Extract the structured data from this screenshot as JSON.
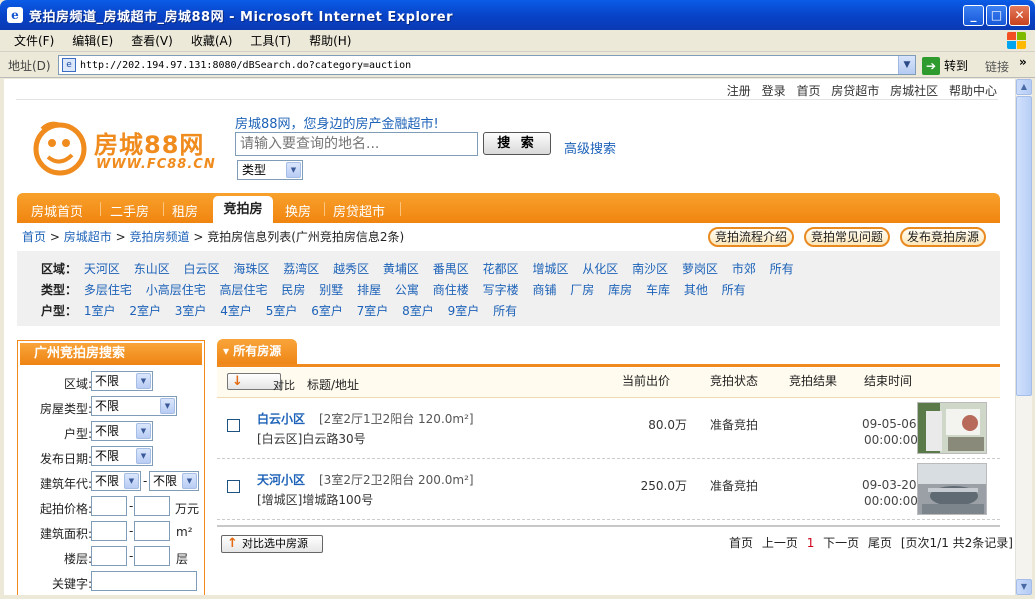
{
  "window": {
    "title": "竞拍房频道_房城超市_房城88网 - Microsoft Internet Explorer",
    "app_icon_glyph": "e",
    "btn_min": "_",
    "btn_max": "□",
    "btn_close": "✕"
  },
  "menu": [
    "文件(F)",
    "编辑(E)",
    "查看(V)",
    "收藏(A)",
    "工具(T)",
    "帮助(H)"
  ],
  "address": {
    "label": "地址(D)",
    "url": "http://202.194.97.131:8080/dBSearch.do?category=auction",
    "go": "转到",
    "links": "链接",
    "chevron": "»"
  },
  "top_links": [
    "注册",
    "登录",
    "首页",
    "房贷超市",
    "房城社区",
    "帮助中心"
  ],
  "logo": {
    "brand": "房城88网",
    "url": "WWW.FC88.CN"
  },
  "search": {
    "slogan": "房城88网，您身边的房产金融超市!",
    "placeholder": "请输入要查询的地名...",
    "button": "搜 索",
    "advanced": "高级搜索",
    "type": "类型"
  },
  "nav": {
    "items": [
      "房城首页",
      "二手房",
      "租房",
      "竞拍房",
      "换房",
      "房贷超市"
    ],
    "active": "竞拍房"
  },
  "breadcrumb": {
    "items": [
      "首页",
      "房城超市",
      "竞拍房频道"
    ],
    "current": "竞拍房信息列表(广州竞拍房信息2条)",
    "sep": ">"
  },
  "pills": [
    "竞拍流程介绍",
    "竞拍常见问题",
    "发布竞拍房源"
  ],
  "filters": {
    "district_label": "区域：",
    "districts": [
      "天河区",
      "东山区",
      "白云区",
      "海珠区",
      "荔湾区",
      "越秀区",
      "黄埔区",
      "番禺区",
      "花都区",
      "增城区",
      "从化区",
      "南沙区",
      "萝岗区",
      "市郊",
      "所有"
    ],
    "type_label": "类型：",
    "types": [
      "多层住宅",
      "小高层住宅",
      "高层住宅",
      "民房",
      "别墅",
      "排屋",
      "公寓",
      "商住楼",
      "写字楼",
      "商铺",
      "厂房",
      "库房",
      "车库",
      "其他",
      "所有"
    ],
    "layout_label": "户型：",
    "layouts": [
      "1室户",
      "2室户",
      "3室户",
      "4室户",
      "5室户",
      "6室户",
      "7室户",
      "8室户",
      "9室户",
      "所有"
    ]
  },
  "left_panel": {
    "title": "广州竞拍房搜索",
    "district_label": "区域:",
    "district_value": "不限",
    "house_type_label": "房屋类型:",
    "house_type_value": "不限",
    "layout_label": "户型:",
    "layout_value": "不限",
    "date_label": "发布日期:",
    "date_value": "不限",
    "year_label": "建筑年代:",
    "year_from": "不限",
    "year_to": "不限",
    "price_label": "起拍价格:",
    "price_unit": "万元",
    "area_label": "建筑面积:",
    "area_unit": "m²",
    "floor_label": "楼层:",
    "floor_unit": "层",
    "keyword_label": "关键字:",
    "dash": "-"
  },
  "listing": {
    "tab": "所有房源",
    "compare": "对比",
    "col_title": "标题/地址",
    "col_price": "当前出价",
    "col_status": "竞拍状态",
    "col_result": "竞拍结果",
    "col_end": "结束时间",
    "rows": [
      {
        "name": "白云小区",
        "spec": "[2室2厅1卫2阳台 120.0m²]",
        "addr": "[白云区]白云路30号",
        "price": "80.0万",
        "status": "准备竞拍",
        "end_date": "09-05-06",
        "end_time": "00:00:00"
      },
      {
        "name": "天河小区",
        "spec": "[3室2厅2卫2阳台 200.0m²]",
        "addr": "[增城区]增城路100号",
        "price": "250.0万",
        "status": "准备竞拍",
        "end_date": "09-03-20",
        "end_time": "00:00:00"
      }
    ],
    "compare_selected": "对比选中房源"
  },
  "pager": {
    "first": "首页",
    "prev": "上一页",
    "current": "1",
    "next": "下一页",
    "last": "尾页",
    "info": "[页次1/1 共2条记录]"
  },
  "colors": {
    "orange": "#f08a1e",
    "link_blue": "#1d62b8",
    "xp_blue": "#0a5ce6"
  }
}
